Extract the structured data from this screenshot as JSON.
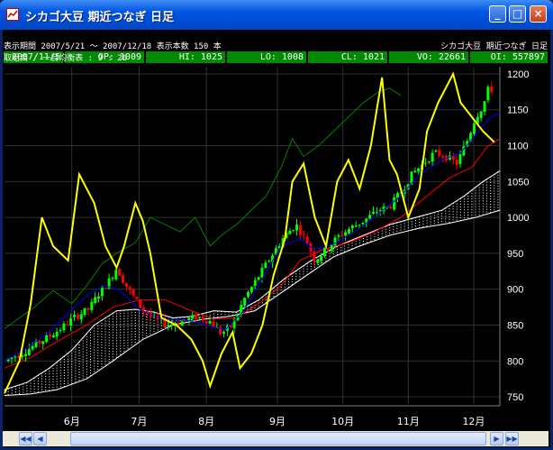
{
  "window": {
    "title": "シカゴ大豆 期近つなぎ 日足",
    "buttons": [
      "minimize",
      "maximize",
      "close"
    ]
  },
  "quote_bar": {
    "date": "2007/11/5",
    "open": "OP: 1009",
    "high": "HI: 1025",
    "low": "LO: 1008",
    "close": "CL: 1021",
    "volume": "VO: 22661",
    "open_interest": "OI: 557897"
  },
  "info": {
    "line1_left": "表示期間 2007/5/21 ～ 2007/12/18 表示本数 150 本",
    "line1_right": "シカゴ大豆 期近つなぎ 日足",
    "line2": "取組高 / 一目均衡表 : 9 : 26"
  },
  "colors": {
    "background": "#000000",
    "grid": "#303030",
    "up_candle": "#00ff00",
    "down_candle": "#ff0000",
    "open_interest_line": "#ffff00",
    "tenkan": "#0000ff",
    "kijun": "#ff0000",
    "chikou": "#008000",
    "senkou_a": "#ffffff",
    "cloud_hatch": "#ffffff",
    "quote_bg": "#008a00"
  },
  "chart_data": {
    "type": "candlestick",
    "y_ticks": [
      "1200",
      "1150",
      "1100",
      "1050",
      "1000",
      "950",
      "900",
      "850",
      "800",
      "750"
    ],
    "ylim": [
      740,
      1210
    ],
    "x_ticks": [
      "6月",
      "7月",
      "8月",
      "9月",
      "10月",
      "11月",
      "12月"
    ],
    "series": [
      {
        "name": "price",
        "points": [
          [
            0,
            800
          ],
          [
            10,
            812
          ],
          [
            20,
            828
          ],
          [
            30,
            845
          ],
          [
            38,
            862
          ],
          [
            45,
            872
          ],
          [
            50,
            892
          ],
          [
            56,
            912
          ],
          [
            60,
            930
          ],
          [
            65,
            905
          ],
          [
            72,
            878
          ],
          [
            80,
            858
          ],
          [
            88,
            850
          ],
          [
            95,
            855
          ],
          [
            103,
            862
          ],
          [
            110,
            855
          ],
          [
            116,
            838
          ],
          [
            122,
            850
          ],
          [
            128,
            885
          ],
          [
            134,
            910
          ],
          [
            140,
            935
          ],
          [
            145,
            955
          ],
          [
            150,
            975
          ],
          [
            156,
            990
          ],
          [
            162,
            965
          ],
          [
            166,
            940
          ],
          [
            172,
            955
          ],
          [
            178,
            972
          ],
          [
            185,
            985
          ],
          [
            192,
            995
          ],
          [
            200,
            1010
          ],
          [
            206,
            1015
          ],
          [
            212,
            1035
          ],
          [
            218,
            1060
          ],
          [
            224,
            1075
          ],
          [
            230,
            1090
          ],
          [
            236,
            1085
          ],
          [
            242,
            1075
          ],
          [
            248,
            1110
          ],
          [
            252,
            1140
          ],
          [
            256,
            1155
          ],
          [
            259,
            1180
          ],
          [
            263,
            1175
          ]
        ]
      },
      {
        "name": "tenkan",
        "points": [
          [
            0,
            800
          ],
          [
            12,
            818
          ],
          [
            24,
            840
          ],
          [
            36,
            872
          ],
          [
            46,
            895
          ],
          [
            54,
            905
          ],
          [
            62,
            898
          ],
          [
            72,
            872
          ],
          [
            84,
            858
          ],
          [
            96,
            858
          ],
          [
            108,
            850
          ],
          [
            118,
            843
          ],
          [
            128,
            870
          ],
          [
            138,
            915
          ],
          [
            148,
            960
          ],
          [
            158,
            970
          ],
          [
            166,
            955
          ],
          [
            178,
            965
          ],
          [
            190,
            985
          ],
          [
            200,
            1005
          ],
          [
            212,
            1030
          ],
          [
            222,
            1060
          ],
          [
            234,
            1080
          ],
          [
            244,
            1090
          ],
          [
            252,
            1115
          ],
          [
            260,
            1140
          ],
          [
            265,
            1145
          ]
        ]
      },
      {
        "name": "kijun",
        "points": [
          [
            0,
            790
          ],
          [
            14,
            805
          ],
          [
            30,
            830
          ],
          [
            44,
            850
          ],
          [
            58,
            875
          ],
          [
            72,
            885
          ],
          [
            86,
            885
          ],
          [
            100,
            870
          ],
          [
            112,
            858
          ],
          [
            124,
            860
          ],
          [
            136,
            880
          ],
          [
            148,
            905
          ],
          [
            158,
            940
          ],
          [
            170,
            955
          ],
          [
            184,
            965
          ],
          [
            198,
            980
          ],
          [
            212,
            1000
          ],
          [
            226,
            1030
          ],
          [
            238,
            1055
          ],
          [
            250,
            1070
          ],
          [
            258,
            1098
          ],
          [
            265,
            1110
          ]
        ]
      },
      {
        "name": "chikou",
        "points": [
          [
            0,
            845
          ],
          [
            8,
            860
          ],
          [
            16,
            875
          ],
          [
            26,
            898
          ],
          [
            36,
            880
          ],
          [
            44,
            905
          ],
          [
            52,
            935
          ],
          [
            60,
            950
          ],
          [
            70,
            965
          ],
          [
            78,
            1000
          ],
          [
            86,
            990
          ],
          [
            94,
            980
          ],
          [
            102,
            1000
          ],
          [
            110,
            960
          ],
          [
            116,
            975
          ],
          [
            124,
            990
          ],
          [
            132,
            1010
          ],
          [
            140,
            1030
          ],
          [
            148,
            1070
          ],
          [
            154,
            1110
          ],
          [
            160,
            1085
          ],
          [
            168,
            1100
          ],
          [
            176,
            1120
          ],
          [
            184,
            1140
          ],
          [
            192,
            1160
          ],
          [
            200,
            1175
          ],
          [
            206,
            1180
          ],
          [
            212,
            1170
          ]
        ]
      },
      {
        "name": "open_interest",
        "points": [
          [
            0,
            755
          ],
          [
            8,
            800
          ],
          [
            14,
            880
          ],
          [
            20,
            1000
          ],
          [
            26,
            960
          ],
          [
            34,
            940
          ],
          [
            40,
            1060
          ],
          [
            48,
            1020
          ],
          [
            54,
            960
          ],
          [
            60,
            930
          ],
          [
            64,
            960
          ],
          [
            70,
            1020
          ],
          [
            74,
            995
          ],
          [
            78,
            950
          ],
          [
            84,
            860
          ],
          [
            92,
            850
          ],
          [
            100,
            830
          ],
          [
            106,
            800
          ],
          [
            110,
            765
          ],
          [
            116,
            810
          ],
          [
            122,
            840
          ],
          [
            126,
            790
          ],
          [
            132,
            810
          ],
          [
            138,
            850
          ],
          [
            144,
            920
          ],
          [
            150,
            970
          ],
          [
            154,
            1050
          ],
          [
            160,
            1075
          ],
          [
            166,
            1000
          ],
          [
            172,
            960
          ],
          [
            178,
            1050
          ],
          [
            184,
            1080
          ],
          [
            190,
            1040
          ],
          [
            196,
            1100
          ],
          [
            202,
            1195
          ],
          [
            206,
            1080
          ],
          [
            210,
            1060
          ],
          [
            216,
            1000
          ],
          [
            222,
            1040
          ],
          [
            226,
            1120
          ],
          [
            232,
            1160
          ],
          [
            240,
            1200
          ],
          [
            244,
            1160
          ],
          [
            250,
            1140
          ],
          [
            256,
            1120
          ],
          [
            262,
            1105
          ]
        ]
      },
      {
        "name": "senkou_a",
        "points": [
          [
            0,
            760
          ],
          [
            12,
            770
          ],
          [
            24,
            790
          ],
          [
            36,
            815
          ],
          [
            48,
            850
          ],
          [
            60,
            870
          ],
          [
            70,
            872
          ],
          [
            80,
            868
          ],
          [
            90,
            860
          ],
          [
            100,
            862
          ],
          [
            112,
            870
          ],
          [
            124,
            868
          ],
          [
            136,
            885
          ],
          [
            150,
            915
          ],
          [
            164,
            940
          ],
          [
            178,
            960
          ],
          [
            192,
            975
          ],
          [
            206,
            990
          ],
          [
            220,
            1000
          ],
          [
            234,
            1010
          ],
          [
            246,
            1030
          ],
          [
            256,
            1050
          ],
          [
            265,
            1065
          ]
        ]
      },
      {
        "name": "senkou_b",
        "points": [
          [
            0,
            752
          ],
          [
            14,
            754
          ],
          [
            28,
            760
          ],
          [
            44,
            775
          ],
          [
            58,
            800
          ],
          [
            74,
            830
          ],
          [
            90,
            850
          ],
          [
            106,
            858
          ],
          [
            120,
            862
          ],
          [
            134,
            870
          ],
          [
            148,
            895
          ],
          [
            162,
            920
          ],
          [
            176,
            945
          ],
          [
            190,
            960
          ],
          [
            206,
            975
          ],
          [
            222,
            985
          ],
          [
            238,
            992
          ],
          [
            252,
            1000
          ],
          [
            265,
            1010
          ]
        ]
      }
    ]
  }
}
